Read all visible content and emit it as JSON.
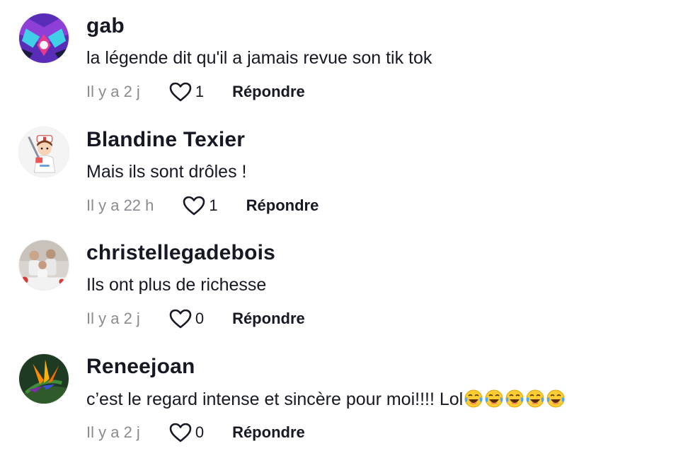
{
  "comments": [
    {
      "username": "gab",
      "text": "la légende dit qu'il a jamais revue son tik tok",
      "time": "Il y a 2 j",
      "likes": "1",
      "reply_label": "Répondre",
      "avatar_icon": "anime-character-avatar"
    },
    {
      "username": "Blandine Texier",
      "text": "Mais ils sont drôles !",
      "time": "Il y a 22 h",
      "likes": "1",
      "reply_label": "Répondre",
      "avatar_icon": "nurse-cartoon-avatar"
    },
    {
      "username": "christellegadebois",
      "text": "Ils ont plus de richesse",
      "time": "Il y a 2 j",
      "likes": "0",
      "reply_label": "Répondre",
      "avatar_icon": "group-photo-avatar"
    },
    {
      "username": "Reneejoan",
      "text": "c’est le regard intense et sincère pour moi!!!! Lol",
      "time": "Il y a 2 j",
      "likes": "0",
      "reply_label": "Répondre",
      "avatar_icon": "bird-of-paradise-flower-avatar",
      "emoji_icon": "laughing-tears-emoji",
      "emoji_count": 5
    }
  ],
  "colors": {
    "text": "#161823",
    "meta": "#8a8b91",
    "background": "#ffffff"
  }
}
